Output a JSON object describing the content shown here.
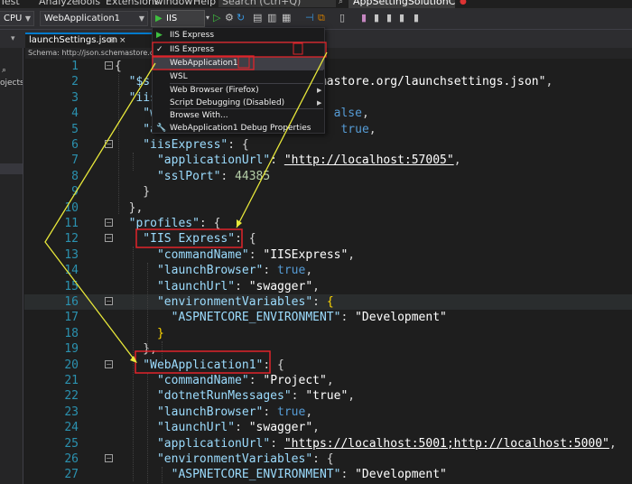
{
  "menubar": {
    "items": [
      "Test",
      "Analyze",
      "Tools",
      "Extensions",
      "Window",
      "Help"
    ],
    "search_label": "Search (Ctrl+Q)",
    "app_title": "AppSettingSolutionCsharp"
  },
  "toolbar": {
    "platform": "CPU",
    "startup_project": "WebApplication1",
    "run_target": "IIS Express"
  },
  "left_panel": {
    "partial_text": "ojects)"
  },
  "tabs": {
    "active_label": "launchSettings.json",
    "pin_glyph": "⊞",
    "close_glyph": "×"
  },
  "schema_bar": {
    "text": "Schema: http://json.schemastore.o"
  },
  "dropdown": {
    "items": [
      {
        "label": "IIS Express",
        "glyph": "▶"
      },
      {
        "label": "IIS Express",
        "glyph": "✓"
      },
      {
        "label": "WebApplication1",
        "glyph": ""
      },
      {
        "label": "WSL",
        "glyph": ""
      },
      {
        "label": "Web Browser (Firefox)",
        "glyph": "",
        "arrow": "▶"
      },
      {
        "label": "Script Debugging (Disabled)",
        "glyph": "",
        "arrow": "▶"
      },
      {
        "label": "Browse With...",
        "glyph": ""
      },
      {
        "label": "WebApplication1 Debug Properties",
        "glyph": "🔧"
      }
    ]
  },
  "editor": {
    "lines": [
      {
        "n": "1",
        "tokens": [
          [
            "p",
            "{"
          ]
        ]
      },
      {
        "n": "2",
        "tokens": [
          [
            "k",
            "  \"$s"
          ],
          [
            "p",
            "                        "
          ],
          [
            "s",
            "mastore.org/launchsettings.json\""
          ],
          [
            "p",
            ","
          ]
        ]
      },
      {
        "n": "3",
        "tokens": [
          [
            "k",
            "  \"iis"
          ]
        ]
      },
      {
        "n": "4",
        "tokens": [
          [
            "k",
            "    \"w"
          ],
          [
            "p",
            "                         "
          ],
          [
            "b",
            "alse"
          ],
          [
            "p",
            ","
          ]
        ]
      },
      {
        "n": "5",
        "tokens": [
          [
            "k",
            "    \"a"
          ],
          [
            "p",
            "                          "
          ],
          [
            "b",
            "true"
          ],
          [
            "p",
            ","
          ]
        ]
      },
      {
        "n": "6",
        "tokens": [
          [
            "k",
            "    \"iisExpress\""
          ],
          [
            "p",
            ": {"
          ]
        ]
      },
      {
        "n": "7",
        "tokens": [
          [
            "k",
            "      \"applicationUrl\""
          ],
          [
            "p",
            ": "
          ],
          [
            "u",
            "\"http://localhost:57005\""
          ],
          [
            "p",
            ","
          ]
        ]
      },
      {
        "n": "8",
        "tokens": [
          [
            "k",
            "      \"sslPort\""
          ],
          [
            "p",
            ": "
          ],
          [
            "n",
            "44385"
          ]
        ]
      },
      {
        "n": "9",
        "tokens": [
          [
            "p",
            "    }"
          ]
        ]
      },
      {
        "n": "10",
        "tokens": [
          [
            "p",
            "  },"
          ]
        ]
      },
      {
        "n": "11",
        "tokens": [
          [
            "k",
            "  \"profiles\""
          ],
          [
            "p",
            ": {"
          ]
        ]
      },
      {
        "n": "12",
        "tokens": [
          [
            "k",
            "    \"IIS Express\""
          ],
          [
            "p",
            ": {"
          ]
        ]
      },
      {
        "n": "13",
        "tokens": [
          [
            "k",
            "      \"commandName\""
          ],
          [
            "p",
            ": "
          ],
          [
            "s",
            "\"IISExpress\""
          ],
          [
            "p",
            ","
          ]
        ]
      },
      {
        "n": "14",
        "tokens": [
          [
            "k",
            "      \"launchBrowser\""
          ],
          [
            "p",
            ": "
          ],
          [
            "b",
            "true"
          ],
          [
            "p",
            ","
          ]
        ]
      },
      {
        "n": "15",
        "tokens": [
          [
            "k",
            "      \"launchUrl\""
          ],
          [
            "p",
            ": "
          ],
          [
            "s",
            "\"swagger\""
          ],
          [
            "p",
            ","
          ]
        ]
      },
      {
        "n": "16",
        "tokens": [
          [
            "k",
            "      \"environmentVariables\""
          ],
          [
            "p",
            ": "
          ],
          [
            "br",
            "{"
          ]
        ]
      },
      {
        "n": "17",
        "tokens": [
          [
            "k",
            "        \"ASPNETCORE_ENVIRONMENT\""
          ],
          [
            "p",
            ": "
          ],
          [
            "s",
            "\"Development\""
          ]
        ]
      },
      {
        "n": "18",
        "tokens": [
          [
            "br",
            "      }"
          ]
        ]
      },
      {
        "n": "19",
        "tokens": [
          [
            "p",
            "    },"
          ]
        ]
      },
      {
        "n": "20",
        "tokens": [
          [
            "k",
            "    \"WebApplication1\""
          ],
          [
            "p",
            ": {"
          ]
        ]
      },
      {
        "n": "21",
        "tokens": [
          [
            "k",
            "      \"commandName\""
          ],
          [
            "p",
            ": "
          ],
          [
            "s",
            "\"Project\""
          ],
          [
            "p",
            ","
          ]
        ]
      },
      {
        "n": "22",
        "tokens": [
          [
            "k",
            "      \"dotnetRunMessages\""
          ],
          [
            "p",
            ": "
          ],
          [
            "s",
            "\"true\""
          ],
          [
            "p",
            ","
          ]
        ]
      },
      {
        "n": "23",
        "tokens": [
          [
            "k",
            "      \"launchBrowser\""
          ],
          [
            "p",
            ": "
          ],
          [
            "b",
            "true"
          ],
          [
            "p",
            ","
          ]
        ]
      },
      {
        "n": "24",
        "tokens": [
          [
            "k",
            "      \"launchUrl\""
          ],
          [
            "p",
            ": "
          ],
          [
            "s",
            "\"swagger\""
          ],
          [
            "p",
            ","
          ]
        ]
      },
      {
        "n": "25",
        "tokens": [
          [
            "k",
            "      \"applicationUrl\""
          ],
          [
            "p",
            ": "
          ],
          [
            "u",
            "\"https://localhost:5001;http://localhost:5000\""
          ],
          [
            "p",
            ","
          ]
        ]
      },
      {
        "n": "26",
        "tokens": [
          [
            "k",
            "      \"environmentVariables\""
          ],
          [
            "p",
            ": {"
          ]
        ]
      },
      {
        "n": "27",
        "tokens": [
          [
            "k",
            "        \"ASPNETCORE_ENVIRONMENT\""
          ],
          [
            "p",
            ": "
          ],
          [
            "s",
            "\"Development\""
          ]
        ]
      }
    ]
  },
  "colors": {
    "annotation_box": "#e0242a",
    "annotation_arrow": "#e8e83a",
    "accent": "#007acc"
  }
}
